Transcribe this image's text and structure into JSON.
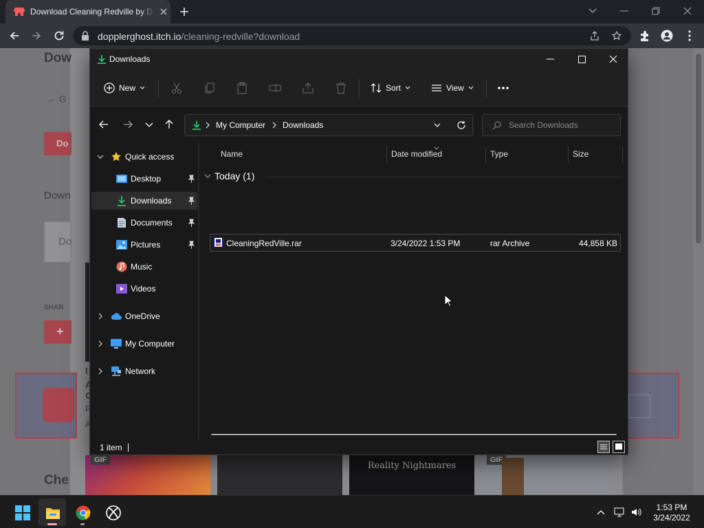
{
  "browser": {
    "tab_title": "Download Cleaning Redville by D",
    "url_host": "dopplerghost.itch.io",
    "url_path": "/cleaning-redville?download"
  },
  "webpage": {
    "fragments": [
      "Dow",
      "← G",
      "Do",
      "Down",
      "Do",
      "SHAR",
      "I",
      "A",
      "C",
      "P",
      "A",
      "Che"
    ],
    "thumbnails": [
      {
        "badge": "GIF",
        "title": ""
      },
      {
        "badge": "",
        "title": ""
      },
      {
        "badge": "",
        "title": "Reality Nightmares"
      },
      {
        "badge": "GIF",
        "title": ""
      }
    ]
  },
  "explorer": {
    "window_title": "Downloads",
    "commands": {
      "new_label": "New",
      "sort_label": "Sort",
      "view_label": "View",
      "more_label": "..."
    },
    "breadcrumb": [
      "My Computer",
      "Downloads"
    ],
    "search_placeholder": "Search Downloads",
    "nav": {
      "quick_access": "Quick access",
      "items": [
        {
          "label": "Desktop",
          "icon": "desktop-icon",
          "pinned": true,
          "selected": false
        },
        {
          "label": "Downloads",
          "icon": "download-icon",
          "pinned": true,
          "selected": true
        },
        {
          "label": "Documents",
          "icon": "documents-icon",
          "pinned": true,
          "selected": false
        },
        {
          "label": "Pictures",
          "icon": "pictures-icon",
          "pinned": true,
          "selected": false
        },
        {
          "label": "Music",
          "icon": "music-icon",
          "pinned": false,
          "selected": false
        },
        {
          "label": "Videos",
          "icon": "videos-icon",
          "pinned": false,
          "selected": false
        }
      ],
      "onedrive": "OneDrive",
      "my_computer": "My Computer",
      "network": "Network"
    },
    "columns": [
      "Name",
      "Date modified",
      "Type",
      "Size"
    ],
    "group_label": "Today (1)",
    "files": [
      {
        "name": "CleaningRedVille.rar",
        "date_modified": "3/24/2022 1:53 PM",
        "type": "rar Archive",
        "size": "44,858 KB",
        "icon": "rar-archive-icon"
      }
    ],
    "status_count": "1 item"
  },
  "taskbar": {
    "apps": [
      "start-icon",
      "file-explorer-icon",
      "chrome-icon",
      "xbox-icon"
    ],
    "time": "1:53 PM",
    "date": "3/24/2022"
  },
  "colors": {
    "accent_green": "#2dbd6e",
    "folder_yellow": "#f3c13a",
    "windows_blue": "#3b9cf0"
  }
}
